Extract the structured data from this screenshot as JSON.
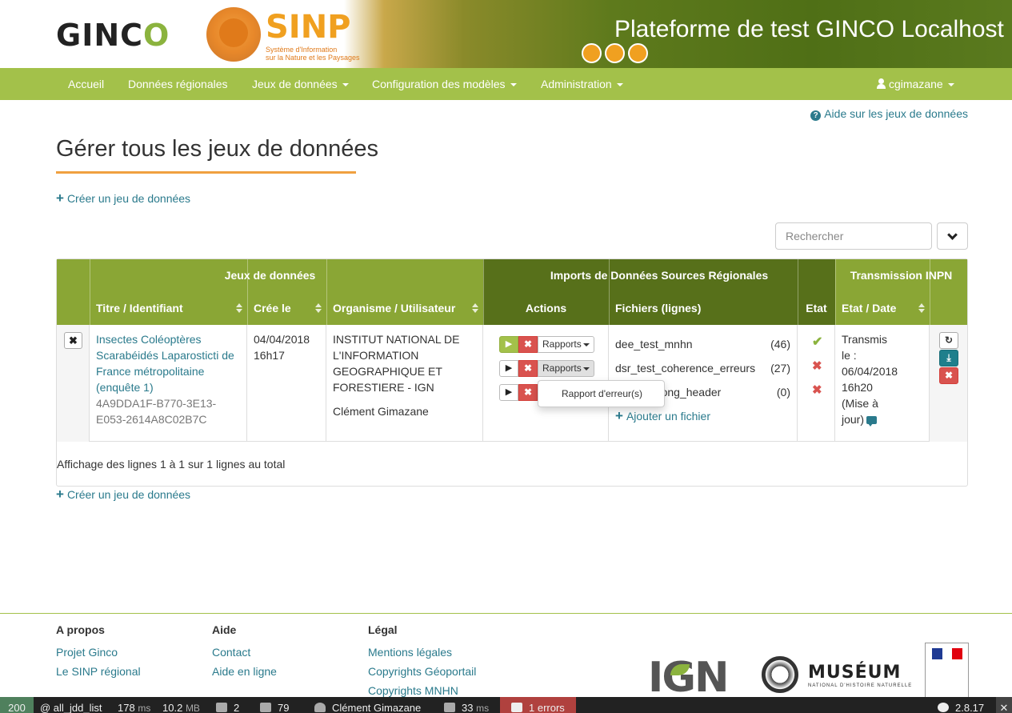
{
  "header": {
    "logo_ginco": "GINC",
    "logo_ginco_tail": "O",
    "logo_sinp": "SINP",
    "sinp_sub_1": "Système d'Information",
    "sinp_sub_2": "sur la Nature et les Paysages",
    "site_title": "Plateforme de test GINCO Localhost"
  },
  "nav": {
    "home": "Accueil",
    "regional": "Données régionales",
    "datasets": "Jeux de données",
    "models": "Configuration des modèles",
    "admin": "Administration",
    "user": "cgimazane"
  },
  "help": {
    "icon": "question-circle-icon",
    "label": "Aide sur les jeux de données"
  },
  "page": {
    "title": "Gérer tous les jeux de données",
    "create_label": "Créer un jeu de données"
  },
  "search": {
    "placeholder": "Rechercher"
  },
  "table": {
    "group_headers": {
      "datasets": "Jeux de données",
      "imports": "Imports de Données Sources Régionales",
      "inpn": "Transmission INPN"
    },
    "columns": {
      "title": "Titre / Identifiant",
      "created": "Crée le",
      "org": "Organisme / Utilisateur",
      "actions": "Actions",
      "files": "Fichiers (lignes)",
      "state": "Etat",
      "state_date": "Etat / Date"
    },
    "colors": {
      "header_light": "#8aa635",
      "header_dark": "#57701a"
    },
    "row": {
      "title": "Insectes Coléoptères Scarabéidés Laparosticti de France métropolitaine (enquête 1)",
      "id": "4A9DDA1F-B770-3E13-E053-2614A8C02B7C",
      "created_date": "04/04/2018",
      "created_time": "16h17",
      "org": "INSTITUT NATIONAL DE L'INFORMATION GEOGRAPHIQUE ET FORESTIERE - IGN",
      "user": "Clément Gimazane",
      "reports_label": "Rapports",
      "dropdown_item": "Rapport d'erreur(s)",
      "files": [
        {
          "name": "dee_test_mnhn",
          "count": "(46)",
          "state": "ok"
        },
        {
          "name": "dsr_test_coherence_erreurs",
          "count": "(27)",
          "state": "error"
        },
        {
          "name": "mnhn_wrong_header",
          "count": "(0)",
          "state": "error"
        }
      ],
      "add_file": "Ajouter un fichier",
      "transmission_1": "Transmis",
      "transmission_2": "le :",
      "transmission_3": "06/04/2018",
      "transmission_4": "16h20",
      "transmission_5": "(Mise à",
      "transmission_6": "jour)"
    },
    "summary": "Affichage des lignes 1 à 1 sur 1 lignes au total"
  },
  "footer": {
    "about": {
      "title": "A propos",
      "links": [
        "Projet Ginco",
        "Le SINP régional"
      ]
    },
    "help": {
      "title": "Aide",
      "links": [
        "Contact",
        "Aide en ligne"
      ]
    },
    "legal": {
      "title": "Légal",
      "links": [
        "Mentions légales",
        "Copyrights Géoportail",
        "Copyrights MNHN"
      ]
    },
    "ign_logo": "IGN",
    "museum_logo": "MUSÉUM",
    "museum_sub": "NATIONAL D'HISTOIRE NATURELLE"
  },
  "toolbar": {
    "status": "200",
    "route": "@ all_jdd_list",
    "time": "178",
    "time_unit": "ms",
    "memory": "10.2",
    "memory_unit": "MB",
    "forms": "2",
    "queries": "79",
    "user": "Clément Gimazane",
    "render": "33",
    "render_unit": "ms",
    "errors": "1 errors",
    "version": "2.8.17"
  }
}
